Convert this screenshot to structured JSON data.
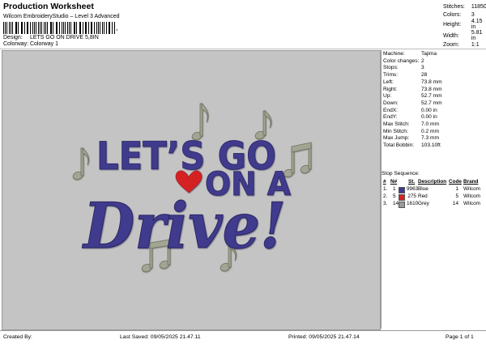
{
  "header": {
    "title": "Production Worksheet",
    "subtitle": "Wilcom EmbroideryStudio – Level 3 Advanced",
    "barcode_text": ","
  },
  "info": {
    "design_label": "Design:",
    "design_value": "LETS GO ON DRIVE 5,8IN",
    "colorway_label": "Colorway:",
    "colorway_value": "Colorway 1"
  },
  "stats": [
    {
      "label": "Stitches:",
      "value": "11850"
    },
    {
      "label": "Colors:",
      "value": "3"
    },
    {
      "label": "Height:",
      "value": "4.15 in"
    },
    {
      "label": "Width:",
      "value": "5.81 in"
    },
    {
      "label": "Zoom:",
      "value": "1:1"
    }
  ],
  "design_art": {
    "line1": "LET’S GO",
    "line2": "ON A",
    "script_word": "Drive!",
    "colors": {
      "blue": "#3f3a8c",
      "red": "#d42424",
      "grey": "#9da08c"
    }
  },
  "machine_info": [
    {
      "label": "Machine:",
      "value": "Tajima"
    },
    {
      "label": "Color changes:",
      "value": "2"
    },
    {
      "label": "Stops:",
      "value": "3"
    },
    {
      "label": "Trims:",
      "value": "28"
    },
    {
      "label": "Left:",
      "value": "73.8 mm"
    },
    {
      "label": "Right:",
      "value": "73.8 mm"
    },
    {
      "label": "Up:",
      "value": "52.7 mm"
    },
    {
      "label": "Down:",
      "value": "52.7 mm"
    },
    {
      "label": "EndX:",
      "value": "0.00 in"
    },
    {
      "label": "EndY:",
      "value": "0.00 in"
    },
    {
      "label": "Max Stitch:",
      "value": "7.0 mm"
    },
    {
      "label": "Min Stitch:",
      "value": "0.2 mm"
    },
    {
      "label": "Max Jump:",
      "value": "7.3 mm"
    },
    {
      "label": "Total Bobbin:",
      "value": "103.10ft"
    }
  ],
  "stop_sequence": {
    "title": "Stop Sequence:",
    "headers": [
      "#",
      "N#",
      "St.",
      "Description",
      "Code",
      "Brand"
    ],
    "rows": [
      {
        "num": "1.",
        "needle": "1",
        "stitches": "9963",
        "color": "#3f3a8c",
        "description": "Blue",
        "code": "1",
        "brand": "Wilcom"
      },
      {
        "num": "2.",
        "needle": "5",
        "stitches": "275",
        "color": "#d42424",
        "description": "Red",
        "code": "5",
        "brand": "Wilcom"
      },
      {
        "num": "3.",
        "needle": "14",
        "stitches": "1610",
        "color": "#9a9a9a",
        "description": "Grey",
        "code": "14",
        "brand": "Wilcom"
      }
    ]
  },
  "footer": {
    "created_by": "Created By:",
    "last_saved": "Last Saved: 09/05/2025 21.47.11",
    "printed": "Printed: 09/05/2025 21.47.14",
    "page": "Page 1 of 1"
  }
}
